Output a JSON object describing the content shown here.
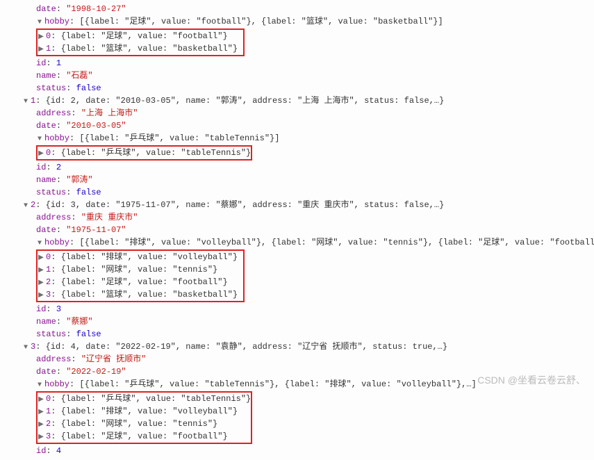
{
  "items": [
    {
      "topDateLabel": "date",
      "topDateValue": "\"1998-10-27\"",
      "hobbySummary": "[{label: \"足球\", value: \"football\"}, {label: \"篮球\", value: \"basketball\"}]",
      "hobbies": [
        "{label: \"足球\", value: \"football\"}",
        "{label: \"篮球\", value: \"basketball\"}"
      ],
      "id": "1",
      "name": "\"石磊\"",
      "status": "false"
    },
    {
      "header": "{id: 2, date: \"2010-03-05\", name: \"郭涛\", address: \"上海 上海市\", status: false,…}",
      "address": "\"上海 上海市\"",
      "date": "\"2010-03-05\"",
      "hobbySummary": "[{label: \"乒乓球\", value: \"tableTennis\"}]",
      "hobbies": [
        "{label: \"乒乓球\", value: \"tableTennis\"}"
      ],
      "id": "2",
      "name": "\"郭涛\"",
      "status": "false"
    },
    {
      "header": "{id: 3, date: \"1975-11-07\", name: \"蔡娜\", address: \"重庆 重庆市\", status: false,…}",
      "address": "\"重庆 重庆市\"",
      "date": "\"1975-11-07\"",
      "hobbySummary": "[{label: \"排球\", value: \"volleyball\"}, {label: \"网球\", value: \"tennis\"}, {label: \"足球\", value: \"football\"},…]",
      "hobbies": [
        "{label: \"排球\", value: \"volleyball\"}",
        "{label: \"网球\", value: \"tennis\"}",
        "{label: \"足球\", value: \"football\"}",
        "{label: \"篮球\", value: \"basketball\"}"
      ],
      "id": "3",
      "name": "\"蔡娜\"",
      "status": "false"
    },
    {
      "header": "{id: 4, date: \"2022-02-19\", name: \"袁静\", address: \"辽宁省 抚顺市\", status: true,…}",
      "address": "\"辽宁省 抚顺市\"",
      "date": "\"2022-02-19\"",
      "hobbySummary": "[{label: \"乒乓球\", value: \"tableTennis\"}, {label: \"排球\", value: \"volleyball\"},…]",
      "hobbies": [
        "{label: \"乒乓球\", value: \"tableTennis\"}",
        "{label: \"排球\", value: \"volleyball\"}",
        "{label: \"网球\", value: \"tennis\"}",
        "{label: \"足球\", value: \"football\"}"
      ],
      "id": "4"
    }
  ],
  "labels": {
    "date": "date",
    "hobby": "hobby",
    "id": "id",
    "name": "name",
    "status": "status",
    "address": "address"
  },
  "watermark": "CSDN @坐看云卷云舒、"
}
